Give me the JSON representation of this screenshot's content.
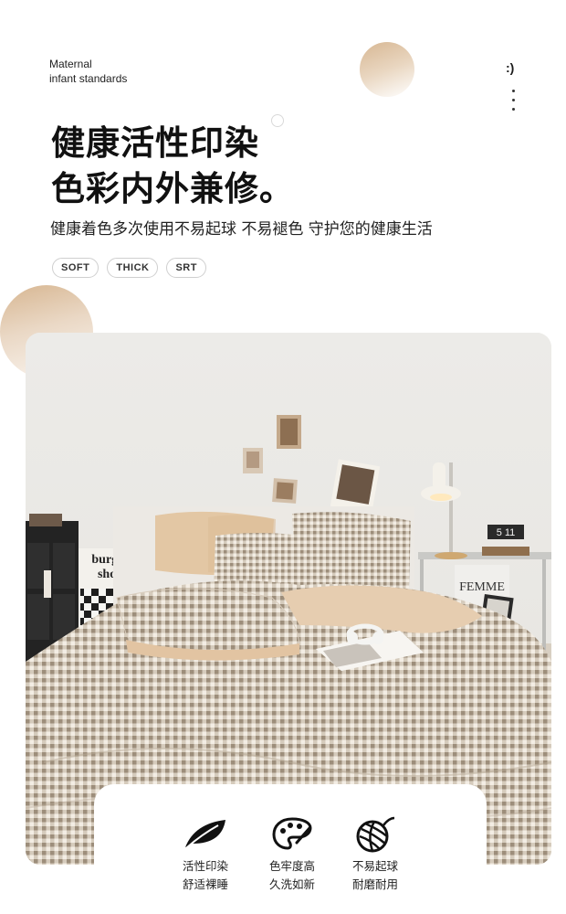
{
  "brand": {
    "line1": "Maternal",
    "line2": "infant standards"
  },
  "top_right": {
    "smile": ":)"
  },
  "headline": {
    "line1": "健康活性印染",
    "line2": "色彩内外兼修。"
  },
  "subtitle": "健康着色多次使用不易起球 不易褪色 守护您的健康生活",
  "tags": [
    "SOFT",
    "THICK",
    "SRT"
  ],
  "photo": {
    "wall_sign": {
      "line1": "burger",
      "line2": "shop"
    },
    "clock": "5 11",
    "frame_text": "FEMME"
  },
  "features": [
    {
      "icon": "leaf-icon",
      "line1": "活性印染",
      "line2": "舒适裸睡"
    },
    {
      "icon": "palette-icon",
      "line1": "色牢度高",
      "line2": "久洗如新"
    },
    {
      "icon": "yarn-ball-icon",
      "line1": "不易起球",
      "line2": "耐磨耐用"
    }
  ],
  "colors": {
    "accent": "#d7b691",
    "sheet_tan": "#e7cfb3",
    "gingham": "#a99a87",
    "wall": "#eeeeec"
  }
}
